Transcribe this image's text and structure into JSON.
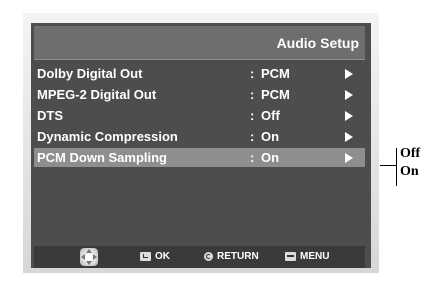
{
  "screen": {
    "title": "Audio Setup"
  },
  "menu": {
    "items": [
      {
        "label": "Dolby Digital Out",
        "colon": ":",
        "value": "PCM",
        "highlighted": false
      },
      {
        "label": "MPEG-2 Digital Out",
        "colon": ":",
        "value": "PCM",
        "highlighted": false
      },
      {
        "label": "DTS",
        "colon": ":",
        "value": "Off",
        "highlighted": false
      },
      {
        "label": "Dynamic Compression",
        "colon": ":",
        "value": "On",
        "highlighted": false
      },
      {
        "label": "PCM Down Sampling",
        "colon": ":",
        "value": "On",
        "highlighted": true
      }
    ]
  },
  "footer": {
    "ok_label": "OK",
    "return_label": "RETURN",
    "menu_label": "MENU"
  },
  "callout": {
    "options": [
      "Off",
      "On"
    ]
  },
  "colors": {
    "screen_bg": "#4d4d4d",
    "highlight": "#8e8e8e",
    "text": "#ffffff"
  }
}
